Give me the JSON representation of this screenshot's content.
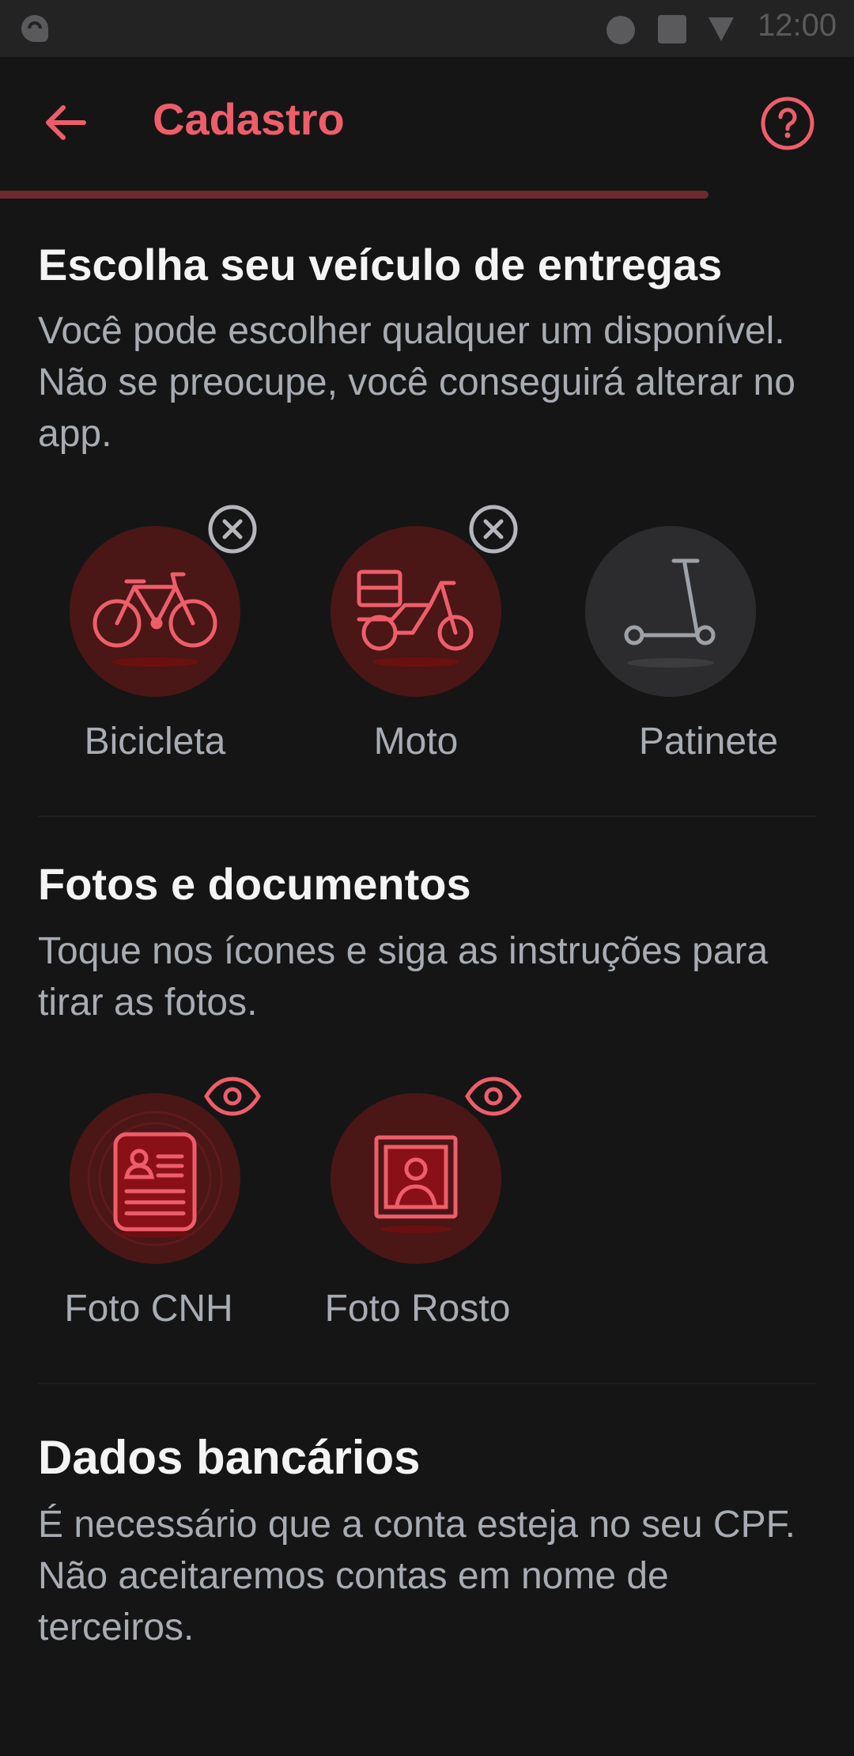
{
  "status_bar": {
    "time": "12:00"
  },
  "header": {
    "title": "Cadastro",
    "progress": 0.83
  },
  "vehicles": {
    "title": "Escolha seu veículo de entregas",
    "description": "Você pode escolher qualquer um disponível. Não se preocupe, você conseguirá alterar no app.",
    "options": [
      {
        "label": "Bicicleta",
        "icon": "bicycle-icon",
        "selected": true
      },
      {
        "label": "Moto",
        "icon": "motorcycle-icon",
        "selected": true
      },
      {
        "label": "Patinete",
        "icon": "scooter-icon",
        "selected": false
      }
    ]
  },
  "documents": {
    "title": "Fotos e documentos",
    "description": "Toque nos ícones e siga as instruções para tirar as fotos.",
    "items": [
      {
        "label": "Foto CNH",
        "icon": "id-card-icon"
      },
      {
        "label": "Foto Rosto",
        "icon": "portrait-icon"
      }
    ]
  },
  "bank": {
    "title": "Dados bancários",
    "description": "É necessário que a conta esteja no seu CPF. Não aceitaremos contas em nome de terceiros."
  },
  "colors": {
    "accent": "#ee5e6a",
    "background": "#151515",
    "active_circle": "#4a1616",
    "inactive_circle": "#2c2c2e",
    "muted_text": "#a8acb3"
  }
}
